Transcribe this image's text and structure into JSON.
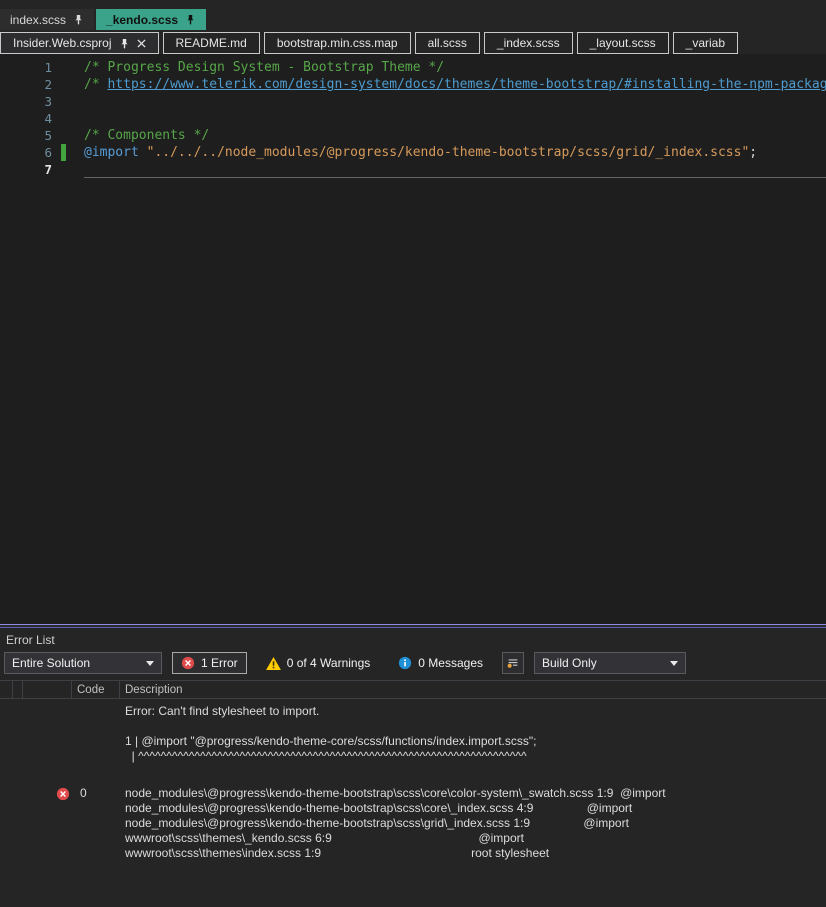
{
  "pinned_tab_row": {
    "tabs": [
      {
        "label": "index.scss",
        "active": false,
        "pinned": true
      },
      {
        "label": "_kendo.scss",
        "active": true,
        "pinned": true
      }
    ]
  },
  "document_tab_row": {
    "tabs": [
      {
        "label": "Insider.Web.csproj",
        "pinned": true,
        "closable": true
      },
      {
        "label": "README.md"
      },
      {
        "label": "bootstrap.min.css.map"
      },
      {
        "label": "all.scss"
      },
      {
        "label": "_index.scss"
      },
      {
        "label": "_layout.scss"
      },
      {
        "label": "_variab"
      }
    ]
  },
  "editor": {
    "lines": [
      {
        "num": "1",
        "tokens": [
          {
            "t": "comment",
            "v": "/* Progress Design System - Bootstrap Theme */"
          }
        ]
      },
      {
        "num": "2",
        "tokens": [
          {
            "t": "comment",
            "v": "/* "
          },
          {
            "t": "link",
            "v": "https://www.telerik.com/design-system/docs/themes/theme-bootstrap/#installing-the-npm-package"
          },
          {
            "t": "comment",
            "v": " */"
          }
        ]
      },
      {
        "num": "3",
        "tokens": []
      },
      {
        "num": "4",
        "tokens": []
      },
      {
        "num": "5",
        "tokens": [
          {
            "t": "comment",
            "v": "/* Components */"
          }
        ]
      },
      {
        "num": "6",
        "modified": true,
        "tokens": [
          {
            "t": "keyword",
            "v": "@import"
          },
          {
            "t": "plain",
            "v": " "
          },
          {
            "t": "string",
            "v": "\"../../../node_modules/@progress/kendo-theme-bootstrap/scss/grid/_index.scss\""
          },
          {
            "t": "plain",
            "v": ";"
          }
        ]
      },
      {
        "num": "7",
        "current": true,
        "tokens": []
      }
    ]
  },
  "error_list": {
    "title": "Error List",
    "toolbar": {
      "scope": "Entire Solution",
      "errors": "1 Error",
      "warnings": "0 of 4 Warnings",
      "messages": "0 Messages",
      "filter": "Build Only"
    },
    "columns": [
      "",
      "",
      "",
      "Code",
      "Description"
    ],
    "entries": [
      {
        "severity": "none",
        "code": "",
        "description_lines": [
          "Error: Can't find stylesheet to import.",
          "",
          "1 | @import \"@progress/kendo-theme-core/scss/functions/index.import.scss\";",
          "  | ^^^^^^^^^^^^^^^^^^^^^^^^^^^^^^^^^^^^^^^^^^^^^^^^^^^^^^^^^^^^^^^^^^^^^"
        ]
      },
      {
        "severity": "error",
        "code": "0",
        "description_lines": [
          "node_modules\\@progress\\kendo-theme-bootstrap\\scss\\core\\color-system\\_swatch.scss 1:9  @import",
          "node_modules\\@progress\\kendo-theme-bootstrap\\scss\\core\\_index.scss 4:9                @import",
          "node_modules\\@progress\\kendo-theme-bootstrap\\scss\\grid\\_index.scss 1:9                @import",
          "wwwroot\\scss\\themes\\_kendo.scss 6:9                                            @import",
          "wwwroot\\scss\\themes\\index.scss 1:9                                             root stylesheet"
        ]
      }
    ]
  },
  "icons": {
    "pin": "pushpin",
    "close": "x",
    "error": "red-circle-x",
    "warning": "yellow-triangle-exclamation",
    "info": "blue-circle-i",
    "dropdown": "chevron-down",
    "options": "list-with-orange-dot"
  },
  "colors": {
    "active_tab": "#3aa38a",
    "splitter_accent": "#8b8be0",
    "error": "#e04a4a",
    "warning": "#ffcc00",
    "info": "#1f8fd6",
    "modified_line_bar": "#45a33f",
    "comment": "#57a64a",
    "keyword": "#569cd6",
    "string": "#d69a5b"
  }
}
